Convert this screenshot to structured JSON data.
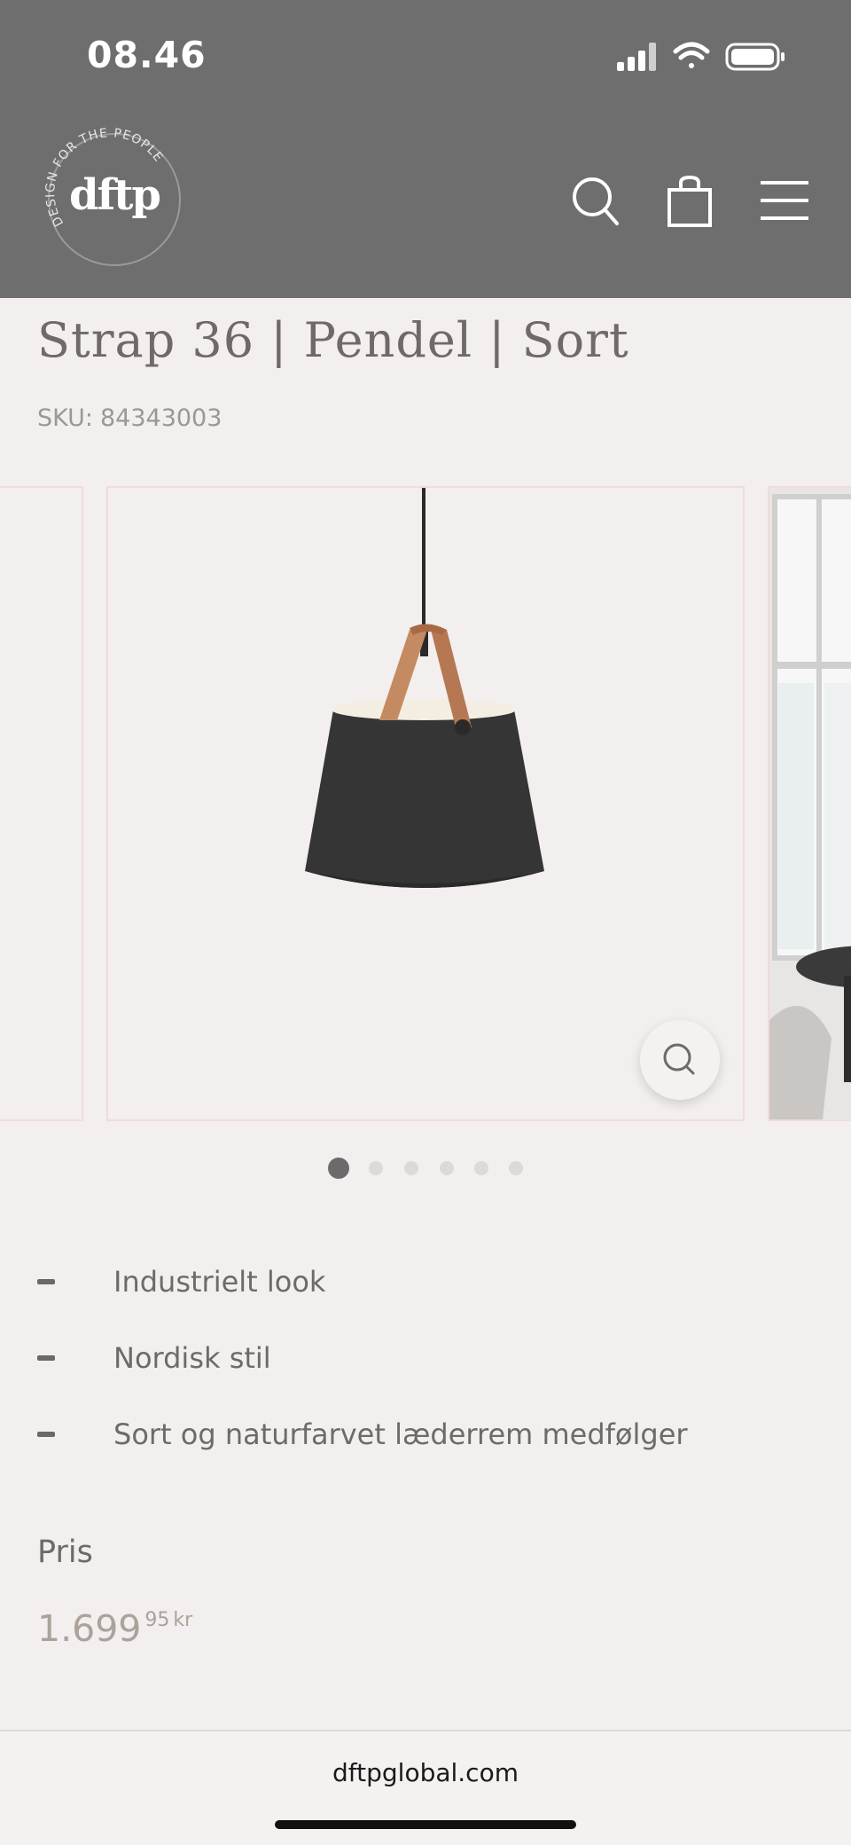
{
  "status_bar": {
    "time": "08.46"
  },
  "header": {
    "logo_text": "dftp",
    "logo_tagline": "DESIGN FOR THE PEOPLE",
    "icons": [
      "search-icon",
      "cart-icon",
      "menu-icon"
    ]
  },
  "product": {
    "title": "Strap 36 | Pendel | Sort",
    "sku_label": "SKU:",
    "sku_value": "84343003",
    "gallery": {
      "image_count": 6,
      "active_index": 0
    },
    "features": [
      "Industrielt look",
      "Nordisk stil",
      "Sort og naturfarvet læderrem medfølger"
    ],
    "price_label": "Pris",
    "price_main": "1.699",
    "price_decimals": "95",
    "price_currency": "kr"
  },
  "browser": {
    "url": "dftpglobal.com"
  },
  "colors": {
    "header_bg": "#6e6e6e",
    "page_bg": "#f2efee",
    "price": "#aba29a",
    "frame_border": "#f0dcd8"
  }
}
